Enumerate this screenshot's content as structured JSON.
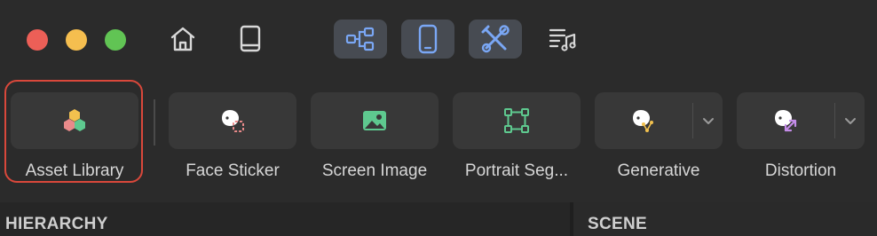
{
  "window": {
    "traffic_lights": {
      "close_color": "#ec5f57",
      "minimize_color": "#f5be4f",
      "zoom_color": "#61c454"
    }
  },
  "titlebar": {
    "icons": [
      {
        "name": "home-icon",
        "active": false
      },
      {
        "name": "book-icon",
        "active": false
      },
      {
        "name": "nodes-icon",
        "active": true
      },
      {
        "name": "phone-icon",
        "active": true
      },
      {
        "name": "tools-icon",
        "active": true
      },
      {
        "name": "music-list-icon",
        "active": false
      }
    ],
    "accent_color": "#7aa7f5"
  },
  "toolbar": {
    "selected_outline_color": "#d9483b",
    "items": [
      {
        "label": "Asset Library",
        "icon": "asset-library-icon",
        "selected": true
      },
      {
        "label": "Face Sticker",
        "icon": "face-sticker-icon",
        "selected": false
      },
      {
        "label": "Screen Image",
        "icon": "screen-image-icon",
        "selected": false
      },
      {
        "label": "Portrait Seg...",
        "icon": "portrait-segmentation-icon",
        "selected": false
      },
      {
        "label": "Generative",
        "icon": "generative-icon",
        "has_dropdown": true
      },
      {
        "label": "Distortion",
        "icon": "distortion-icon",
        "has_dropdown": true
      }
    ]
  },
  "panels": {
    "hierarchy_title": "HIERARCHY",
    "scene_title": "SCENE"
  }
}
